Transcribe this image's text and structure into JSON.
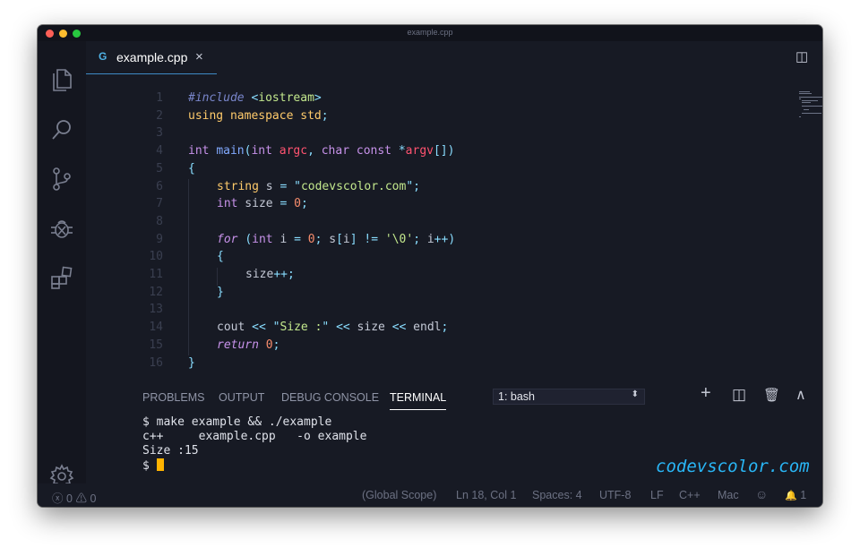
{
  "window": {
    "title": "example.cpp"
  },
  "activity_bar": [
    {
      "icon": "files-icon"
    },
    {
      "icon": "search-icon"
    },
    {
      "icon": "source-control-icon"
    },
    {
      "icon": "debug-icon"
    },
    {
      "icon": "extensions-icon"
    },
    {
      "icon": "settings-gear-icon"
    }
  ],
  "tab": {
    "icon": "C++ file icon",
    "icon_glyph": "G",
    "label": "example.cpp",
    "close": "×"
  },
  "editor_actions": {
    "split_glyph": "◫",
    "more_glyph": "···"
  },
  "code_lines": [
    {
      "n": "1",
      "indent": 0,
      "tokens": [
        [
          "#include",
          "#7986cb",
          "i"
        ],
        [
          " ",
          null
        ],
        [
          "<",
          "#89ddff"
        ],
        [
          "iostream",
          "#c3e88d"
        ],
        [
          ">",
          "#89ddff"
        ]
      ]
    },
    {
      "n": "2",
      "indent": 0,
      "tokens": [
        [
          "using",
          "#ffcb6b"
        ],
        [
          " ",
          null
        ],
        [
          "namespace",
          "#ffcb6b"
        ],
        [
          " ",
          null
        ],
        [
          "std",
          "#ffcb6b"
        ],
        [
          ";",
          "#89ddff"
        ]
      ]
    },
    {
      "n": "3",
      "indent": 0,
      "tokens": []
    },
    {
      "n": "4",
      "indent": 0,
      "tokens": [
        [
          "int",
          "#c792ea"
        ],
        [
          " ",
          null
        ],
        [
          "main",
          "#82aaff"
        ],
        [
          "(",
          "#89ddff"
        ],
        [
          "int",
          "#c792ea"
        ],
        [
          " ",
          null
        ],
        [
          "argc",
          "#ff5370"
        ],
        [
          ", ",
          "#89ddff"
        ],
        [
          "char",
          "#c792ea"
        ],
        [
          " ",
          null
        ],
        [
          "const",
          "#c792ea"
        ],
        [
          " ",
          null
        ],
        [
          "*",
          "#89ddff"
        ],
        [
          "argv",
          "#ff5370"
        ],
        [
          "[])",
          "#89ddff"
        ]
      ]
    },
    {
      "n": "5",
      "indent": 0,
      "tokens": [
        [
          "{",
          "#89ddff"
        ]
      ]
    },
    {
      "n": "6",
      "indent": 1,
      "tokens": [
        [
          "string",
          "#ffcb6b"
        ],
        [
          " s ",
          null
        ],
        [
          "=",
          "#89ddff"
        ],
        [
          " ",
          null
        ],
        [
          "\"",
          "#89ddff"
        ],
        [
          "codevscolor.com",
          "#c3e88d"
        ],
        [
          "\"",
          "#89ddff"
        ],
        [
          ";",
          "#89ddff"
        ]
      ]
    },
    {
      "n": "7",
      "indent": 1,
      "tokens": [
        [
          "int",
          "#c792ea"
        ],
        [
          " size ",
          null
        ],
        [
          "=",
          "#89ddff"
        ],
        [
          " ",
          null
        ],
        [
          "0",
          "#f78c6c"
        ],
        [
          ";",
          "#89ddff"
        ]
      ]
    },
    {
      "n": "8",
      "indent": 0,
      "tokens": []
    },
    {
      "n": "9",
      "indent": 1,
      "tokens": [
        [
          "for",
          "#c792ea",
          "i"
        ],
        [
          " ",
          null
        ],
        [
          "(",
          "#89ddff"
        ],
        [
          "int",
          "#c792ea"
        ],
        [
          " i ",
          null
        ],
        [
          "=",
          "#89ddff"
        ],
        [
          " ",
          null
        ],
        [
          "0",
          "#f78c6c"
        ],
        [
          "; ",
          "#89ddff"
        ],
        [
          "s",
          null
        ],
        [
          "[",
          "#89ddff"
        ],
        [
          "i",
          null
        ],
        [
          "]",
          "#89ddff"
        ],
        [
          " ",
          null
        ],
        [
          "!=",
          "#89ddff"
        ],
        [
          " ",
          null
        ],
        [
          "'\\0'",
          "#c3e88d"
        ],
        [
          "; ",
          "#89ddff"
        ],
        [
          "i",
          null
        ],
        [
          "++",
          "#89ddff"
        ],
        [
          ")",
          "#89ddff"
        ]
      ]
    },
    {
      "n": "10",
      "indent": 1,
      "tokens": [
        [
          "{",
          "#89ddff"
        ]
      ]
    },
    {
      "n": "11",
      "indent": 2,
      "tokens": [
        [
          "size",
          null
        ],
        [
          "++",
          "#89ddff"
        ],
        [
          ";",
          "#89ddff"
        ]
      ]
    },
    {
      "n": "12",
      "indent": 1,
      "tokens": [
        [
          "}",
          "#89ddff"
        ]
      ]
    },
    {
      "n": "13",
      "indent": 0,
      "tokens": []
    },
    {
      "n": "14",
      "indent": 1,
      "tokens": [
        [
          "cout",
          null
        ],
        [
          " ",
          null
        ],
        [
          "<<",
          "#89ddff"
        ],
        [
          " ",
          null
        ],
        [
          "\"",
          "#89ddff"
        ],
        [
          "Size :",
          "#c3e88d"
        ],
        [
          "\"",
          "#89ddff"
        ],
        [
          " ",
          null
        ],
        [
          "<<",
          "#89ddff"
        ],
        [
          " size ",
          null
        ],
        [
          "<<",
          "#89ddff"
        ],
        [
          " endl",
          null
        ],
        [
          ";",
          "#89ddff"
        ]
      ]
    },
    {
      "n": "15",
      "indent": 1,
      "tokens": [
        [
          "return",
          "#c792ea",
          "i"
        ],
        [
          " ",
          null
        ],
        [
          "0",
          "#f78c6c"
        ],
        [
          ";",
          "#89ddff"
        ]
      ]
    },
    {
      "n": "16",
      "indent": 0,
      "tokens": [
        [
          "}",
          "#89ddff"
        ]
      ]
    }
  ],
  "panel": {
    "tabs": [
      "PROBLEMS",
      "OUTPUT",
      "DEBUG CONSOLE",
      "TERMINAL"
    ],
    "active_tab": "TERMINAL",
    "terminal_select": "1: bash",
    "select_arrow": "⬍",
    "icons": {
      "add": "+",
      "split": "◫",
      "trash": "🗑",
      "maximize": "∧",
      "close": "×"
    },
    "terminal_lines": [
      "$ make example && ./example",
      "c++     example.cpp   -o example",
      "Size :15",
      "$ "
    ]
  },
  "watermark": "codevscolor.com",
  "statusbar": {
    "error_icon": "ⓧ",
    "errors": "0",
    "warning_icon": "⚠",
    "warnings": "0",
    "scope": "(Global Scope)",
    "position": "Ln 18, Col 1",
    "spaces": "Spaces: 4",
    "encoding": "UTF-8",
    "eol": "LF",
    "language": "C++",
    "platform": "Mac",
    "feedback_icon": "☺",
    "bell_icon": "🔔",
    "notifications": "1"
  },
  "colors": {
    "background": "#171a24",
    "activity_bar": "#14161f",
    "accent_tab_border": "#3e8ac6",
    "cursor": "#ffb300",
    "watermark": "#29b6f6"
  }
}
